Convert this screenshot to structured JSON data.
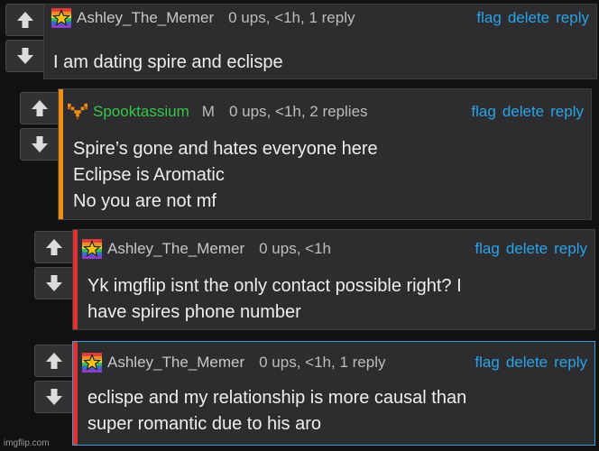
{
  "comments": [
    {
      "username": "Ashley_The_Memer",
      "gender": "",
      "meta": "0 ups, <1h, 1 reply",
      "actions": {
        "flag": "flag",
        "delete": "delete",
        "reply": "reply"
      },
      "lines": [
        "I am dating spire and eclispe"
      ],
      "bar_color": "",
      "avatar": "rainbow-star-icon"
    },
    {
      "username": "Spooktassium",
      "gender": "M",
      "meta": "0 ups, <1h, 2 replies",
      "actions": {
        "flag": "flag",
        "delete": "delete",
        "reply": "reply"
      },
      "lines": [
        "Spire’s gone and hates everyone here",
        "Eclipse is Aromatic",
        "No you are not mf"
      ],
      "bar_color": "#f08c14",
      "avatar": "orange-pixel-v-icon"
    },
    {
      "username": "Ashley_The_Memer",
      "gender": "",
      "meta": "0 ups, <1h",
      "actions": {
        "flag": "flag",
        "delete": "delete",
        "reply": "reply"
      },
      "lines": [
        "Yk imgflip isnt the only contact possible right? I",
        "have spires phone number"
      ],
      "bar_color": "#e03232",
      "avatar": "rainbow-star-icon"
    },
    {
      "username": "Ashley_The_Memer",
      "gender": "",
      "meta": "0 ups, <1h, 1 reply",
      "actions": {
        "flag": "flag",
        "delete": "delete",
        "reply": "reply"
      },
      "lines": [
        "eclispe and my relationship is more causal than",
        "super romantic due to his aro"
      ],
      "bar_color": "#e03232",
      "avatar": "rainbow-star-icon"
    }
  ],
  "watermark": "imgflip.com",
  "colors": {
    "link": "#2aa3e8",
    "selected_border": "#3a9fd5",
    "background": "#111112"
  }
}
